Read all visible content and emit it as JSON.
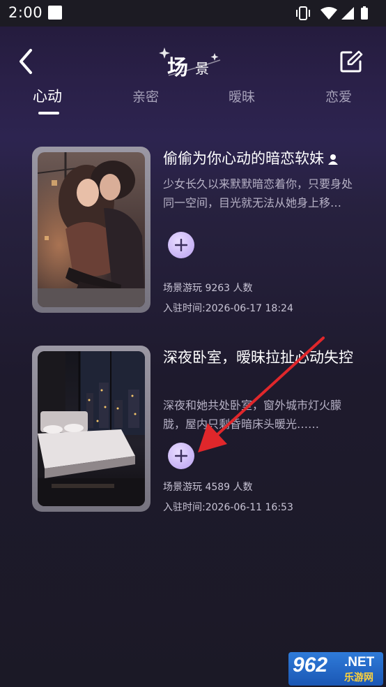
{
  "status_bar": {
    "time": "2:00"
  },
  "header": {
    "title_main": "场",
    "title_sub": "景",
    "back_icon": "chevron-left-icon",
    "edit_icon": "edit-square-icon"
  },
  "tabs": [
    {
      "label": "心动",
      "active": true
    },
    {
      "label": "亲密",
      "active": false
    },
    {
      "label": "暧昧",
      "active": false
    },
    {
      "label": "恋爱",
      "active": false
    }
  ],
  "cards": [
    {
      "title": "偷偷为你心动的暗恋软妹",
      "description": "少女长久以来默默暗恋着你，只要身处同一空间，目光就无法从她身上移开……",
      "players": "场景游玩 9263 人数",
      "joined": "入驻时间:2026-06-17 18:24",
      "has_user_icon": true
    },
    {
      "title": "深夜卧室，暧昧拉扯心动失控",
      "description": "深夜和她共处卧室，窗外城市灯火朦胧，屋内只剩昏暗床头暖光……",
      "players": "场景游玩 4589 人数",
      "joined": "入驻时间:2026-06-11 16:53",
      "has_user_icon": false
    }
  ],
  "watermark": {
    "number": "962",
    "suffix": ".NET",
    "sub": "乐游网"
  },
  "colors": {
    "accent_purple": "#b9a0f0",
    "annotation_red": "#e0272b",
    "watermark_blue": "#2f7bd9"
  }
}
